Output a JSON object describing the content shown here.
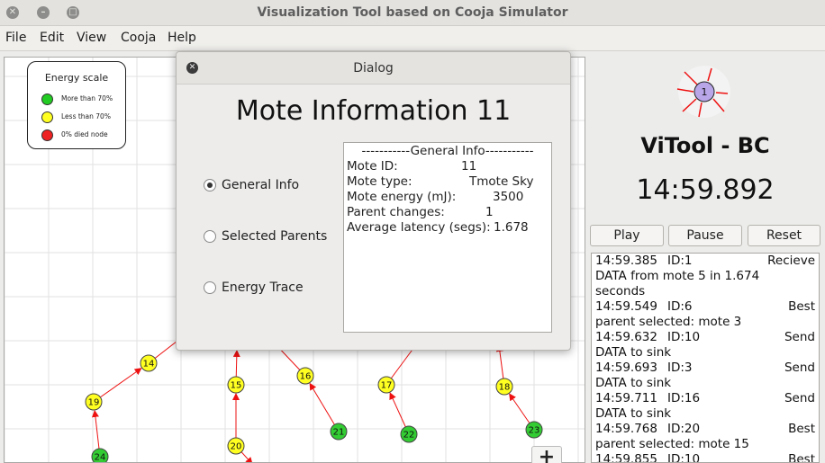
{
  "window": {
    "title": "Visualization Tool based on Cooja Simulator",
    "controls": [
      "close",
      "minimize",
      "maximize"
    ]
  },
  "menu": [
    "File",
    "Edit",
    "View",
    "Cooja",
    "Help"
  ],
  "legend": {
    "title": "Energy scale",
    "items": [
      {
        "label": "More than 70%",
        "color": "#22cc22"
      },
      {
        "label": "Less than 70%",
        "color": "#ffff22"
      },
      {
        "label": "0% died node",
        "color": "#ee2222"
      }
    ]
  },
  "motes": [
    {
      "id": "14",
      "color": "#ffff22"
    },
    {
      "id": "19",
      "color": "#ffff22"
    },
    {
      "id": "24",
      "color": "#33cc33"
    },
    {
      "id": "15",
      "color": "#ffff22"
    },
    {
      "id": "20",
      "color": "#ffff22"
    },
    {
      "id": "16",
      "color": "#ffff22"
    },
    {
      "id": "21",
      "color": "#33cc33"
    },
    {
      "id": "17",
      "color": "#ffff22"
    },
    {
      "id": "22",
      "color": "#33cc33"
    },
    {
      "id": "18",
      "color": "#ffff22"
    },
    {
      "id": "23",
      "color": "#33cc33"
    }
  ],
  "zoom_label": "+",
  "logo_node_label": "1",
  "app_name": "ViTool - BC",
  "clock": "14:59.892",
  "buttons": {
    "play": "Play",
    "pause": "Pause",
    "reset": "Reset"
  },
  "log": [
    {
      "time": "14:59.385",
      "id": "ID:1",
      "action": "Recieve",
      "rest": [
        "DATA from mote 5 in 1.674",
        "seconds"
      ]
    },
    {
      "time": "14:59.549",
      "id": "ID:6",
      "action": "Best",
      "rest": [
        "parent selected: mote 3"
      ]
    },
    {
      "time": "14:59.632",
      "id": "ID:10",
      "action": "Send",
      "rest": [
        "DATA to sink"
      ]
    },
    {
      "time": "14:59.693",
      "id": "ID:3",
      "action": "Send",
      "rest": [
        "DATA to sink"
      ]
    },
    {
      "time": "14:59.711",
      "id": "ID:16",
      "action": "Send",
      "rest": [
        "DATA to sink"
      ]
    },
    {
      "time": "14:59.768",
      "id": "ID:20",
      "action": "Best",
      "rest": [
        "parent selected: mote 15"
      ]
    },
    {
      "time": "14:59.855",
      "id": "ID:10",
      "action": "Best",
      "rest": []
    }
  ],
  "dialog": {
    "title": "Dialog",
    "heading": "Mote Information 11",
    "radios": [
      {
        "label": "General Info",
        "selected": true
      },
      {
        "label": "Selected Parents",
        "selected": false
      },
      {
        "label": "Energy Trace",
        "selected": false
      }
    ],
    "info_header": "-----------General Info-----------",
    "info_rows": [
      {
        "label": "Mote ID:",
        "value": "11"
      },
      {
        "label": "Mote type:",
        "value": "Tmote Sky"
      },
      {
        "label": "Mote energy (mJ):",
        "value": "3500"
      },
      {
        "label": "Parent changes:",
        "value": "1"
      },
      {
        "label": "Average latency (segs):",
        "value": "1.678"
      }
    ]
  }
}
